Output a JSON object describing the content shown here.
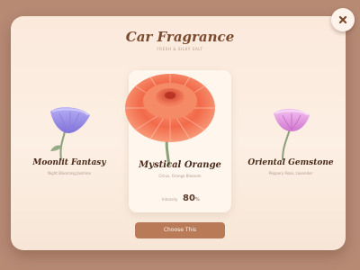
{
  "modal": {
    "title": "Car Fragrance",
    "subtitle": "FRESH & SILKY SALT",
    "close_icon": "close-icon"
  },
  "options": [
    {
      "name": "Moonlit Fantasy",
      "description": "Night Blooming Jasmine",
      "icon": "purple-flower-icon",
      "color": "#9b8ee6"
    },
    {
      "name": "Mystical Orange",
      "description": "Citrus, Orange Blossom",
      "icon": "orange-flower-icon",
      "color": "#f06c4c",
      "intensity_label": "Intensity",
      "intensity_value": "80",
      "intensity_unit": "%"
    },
    {
      "name": "Oriental Gemstone",
      "description": "Peppery Rose, Lavender",
      "icon": "pink-flower-icon",
      "color": "#e79bde"
    }
  ],
  "selected_index": 1,
  "cta": {
    "label": "Choose This"
  },
  "colors": {
    "backdrop": "#b78a74",
    "card": "#fcefe3",
    "button": "#b97a58",
    "title": "#7a4a2d"
  }
}
